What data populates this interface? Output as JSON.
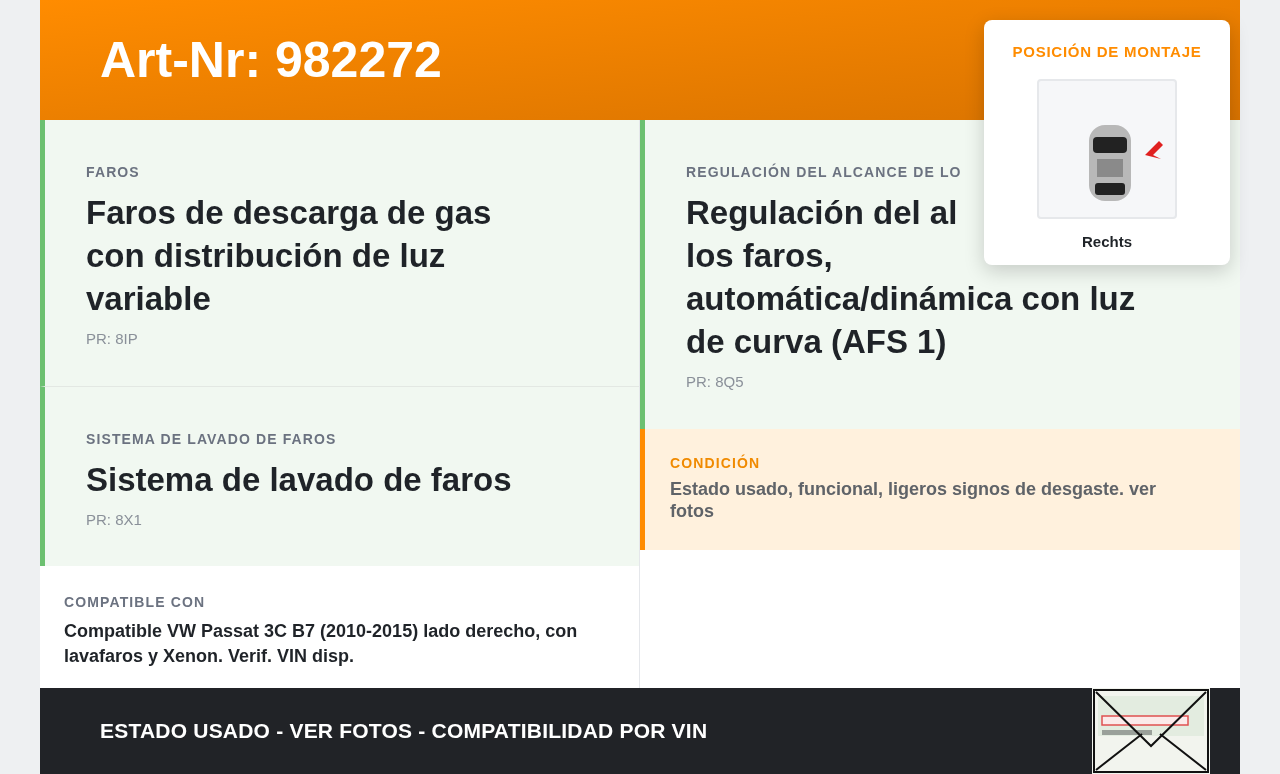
{
  "header": {
    "title": "Art-Nr: 982272"
  },
  "left_features": [
    {
      "label": "FAROS",
      "title_lines": [
        "Faros de descarga de gas",
        "con distribución de luz",
        "variable"
      ],
      "code": "PR: 8IP"
    },
    {
      "label": "SISTEMA DE LAVADO DE FAROS",
      "title_lines": [
        "Sistema de lavado de faros"
      ],
      "code": "PR: 8X1"
    }
  ],
  "right_features": [
    {
      "label": "REGULACIÓN DEL ALCANCE DE LO",
      "title_lines": [
        "Regulación del al",
        "los faros,",
        "automática/dinámica con luz",
        "de curva (AFS 1)"
      ],
      "code": "PR: 8Q5"
    }
  ],
  "compatible": {
    "label": "COMPATIBLE CON",
    "text": "Compatible VW Passat 3C B7 (2010-2015) lado derecho, con lavafaros y Xenon. Verif. VIN disp."
  },
  "condition": {
    "label": "CONDICIÓN",
    "text": "Estado usado, funcional, ligeros signos de desgaste. ver fotos"
  },
  "mounting": {
    "title": "POSICIÓN DE MONTAJE",
    "side": "Rechts"
  },
  "footer": {
    "text": "ESTADO USADO - VER FOTOS - COMPATIBILIDAD POR VIN"
  }
}
